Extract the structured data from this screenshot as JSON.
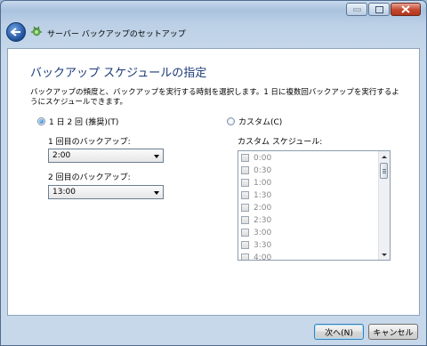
{
  "window": {
    "title": "サーバー バックアップのセットアップ"
  },
  "page": {
    "heading": "バックアップ スケジュールの指定",
    "description": "バックアップの頻度と、バックアップを実行する時刻を選択します。1 日に複数回バックアップを実行するようにスケジュールできます。"
  },
  "options": {
    "twice_daily": {
      "label": "1 日 2 回 (推奨)(T)",
      "selected": true,
      "first_label": "1 回目のバックアップ:",
      "first_value": "2:00",
      "second_label": "2 回目のバックアップ:",
      "second_value": "13:00"
    },
    "custom": {
      "label": "カスタム(C)",
      "selected": false,
      "schedule_label": "カスタム スケジュール:",
      "times": [
        "0:00",
        "0:30",
        "1:00",
        "1:30",
        "2:00",
        "2:30",
        "3:00",
        "3:30",
        "4:00"
      ]
    }
  },
  "buttons": {
    "next": "次へ(N)",
    "cancel": "キャンセル"
  }
}
